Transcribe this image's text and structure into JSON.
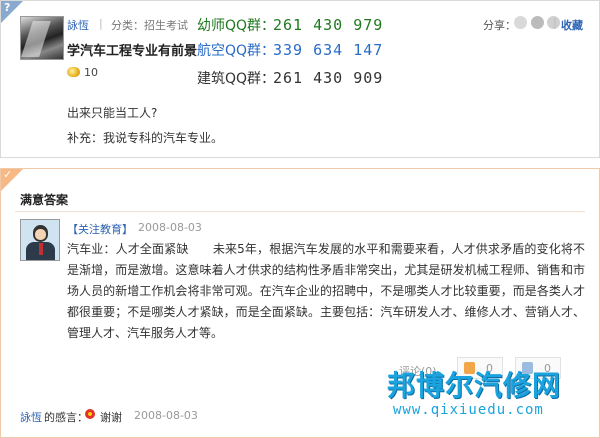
{
  "question": {
    "corner_label": "?",
    "asker": "詠恆",
    "separator": "|",
    "category": "分类：招生考试",
    "title": "学汽车工程专业有前景",
    "reward": "10",
    "body": "出来只能当工人?",
    "supplement": "补充：我说专科的汽车专业。",
    "share_label": "分享：",
    "collect": "收藏"
  },
  "qq_groups": [
    {
      "label": "幼师QQ群：",
      "number": "261 430 979"
    },
    {
      "label": "航空QQ群：",
      "number": "339 634 147"
    },
    {
      "label": "建筑QQ群：",
      "number": "261 430 909"
    }
  ],
  "answer": {
    "corner_label": "✓",
    "heading": "满意答案",
    "answerer": "【关注教育】",
    "date": "2008-08-03",
    "text": "汽车业：人才全面紧缺　　未来5年，根据汽车发展的水平和需要来看，人才供求矛盾的变化将不是渐增，而是激增。这意味着人才供求的结构性矛盾非常突出，尤其是研发机械工程师、销售和市场人员的新增工作机会将非常可观。在汽车企业的招聘中，不是哪类人才比较重要，而是各类人才都很重要；不是哪类人才紧缺，而是全面紧缺。主要包括：汽车研发人才、维修人才、营销人才、管理人才、汽车服务人才等。",
    "comments": "评论(0)",
    "upvotes": "0",
    "downvotes": "0"
  },
  "thanks": {
    "user": "詠恆",
    "label": "的感言：",
    "text": "谢谢",
    "date": "2008-08-03"
  },
  "watermark": {
    "name": "邦博尔汽修网",
    "url": "www.qixiuedu.com"
  }
}
